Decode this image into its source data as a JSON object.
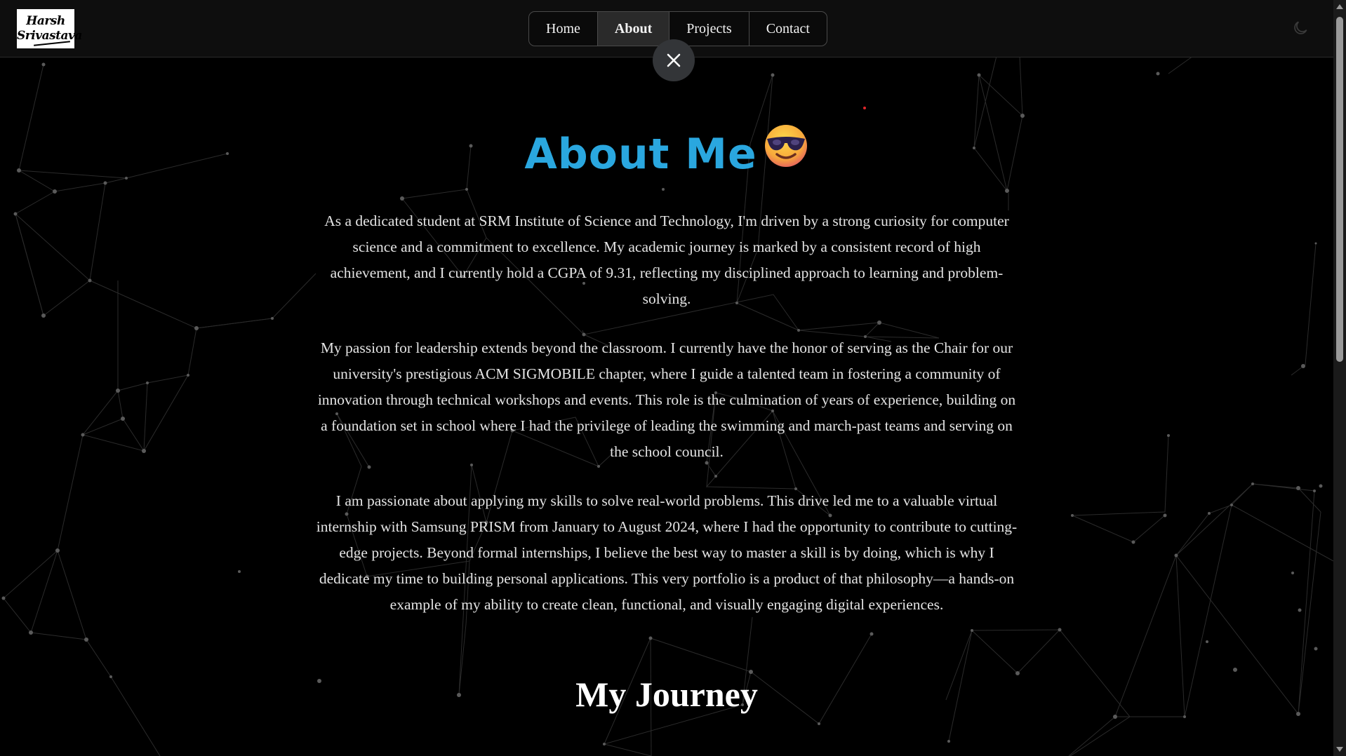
{
  "logo": {
    "line1": "Harsh",
    "line2": "Srivastava"
  },
  "nav": {
    "items": [
      {
        "label": "Home"
      },
      {
        "label": "About"
      },
      {
        "label": "Projects"
      },
      {
        "label": "Contact"
      }
    ],
    "active": "About"
  },
  "icons": {
    "theme_toggle": "moon-icon",
    "close": "close-icon",
    "title_emoji": "smiling-face-with-sunglasses-icon"
  },
  "about": {
    "title": "About Me",
    "paragraphs": [
      "As a dedicated student at SRM Institute of Science and Technology, I'm driven by a strong curiosity for computer science and a commitment to excellence. My academic journey is marked by a consistent record of high achievement, and I currently hold a CGPA of 9.31, reflecting my disciplined approach to learning and problem-solving.",
      "My passion for leadership extends beyond the classroom. I currently have the honor of serving as the Chair for our university's prestigious ACM SIGMOBILE chapter, where I guide a talented team in fostering a community of innovation through technical workshops and events. This role is the culmination of years of experience, building on a foundation set in school where I had the privilege of leading the swimming and march-past teams and serving on the school council.",
      "I am passionate about applying my skills to solve real-world problems. This drive led me to a valuable virtual internship with Samsung PRISM from January to August 2024, where I had the opportunity to contribute to cutting-edge projects. Beyond formal internships, I believe the best way to master a skill is by doing, which is why I dedicate my time to building personal applications. This very portfolio is a product of that philosophy—a hands-on example of my ability to create clean, functional, and visually engaging digital experiences."
    ]
  },
  "journey": {
    "title": "My Journey"
  },
  "colors": {
    "accent": "#2aa7df",
    "background": "#000000",
    "header": "#0e0e0e"
  }
}
